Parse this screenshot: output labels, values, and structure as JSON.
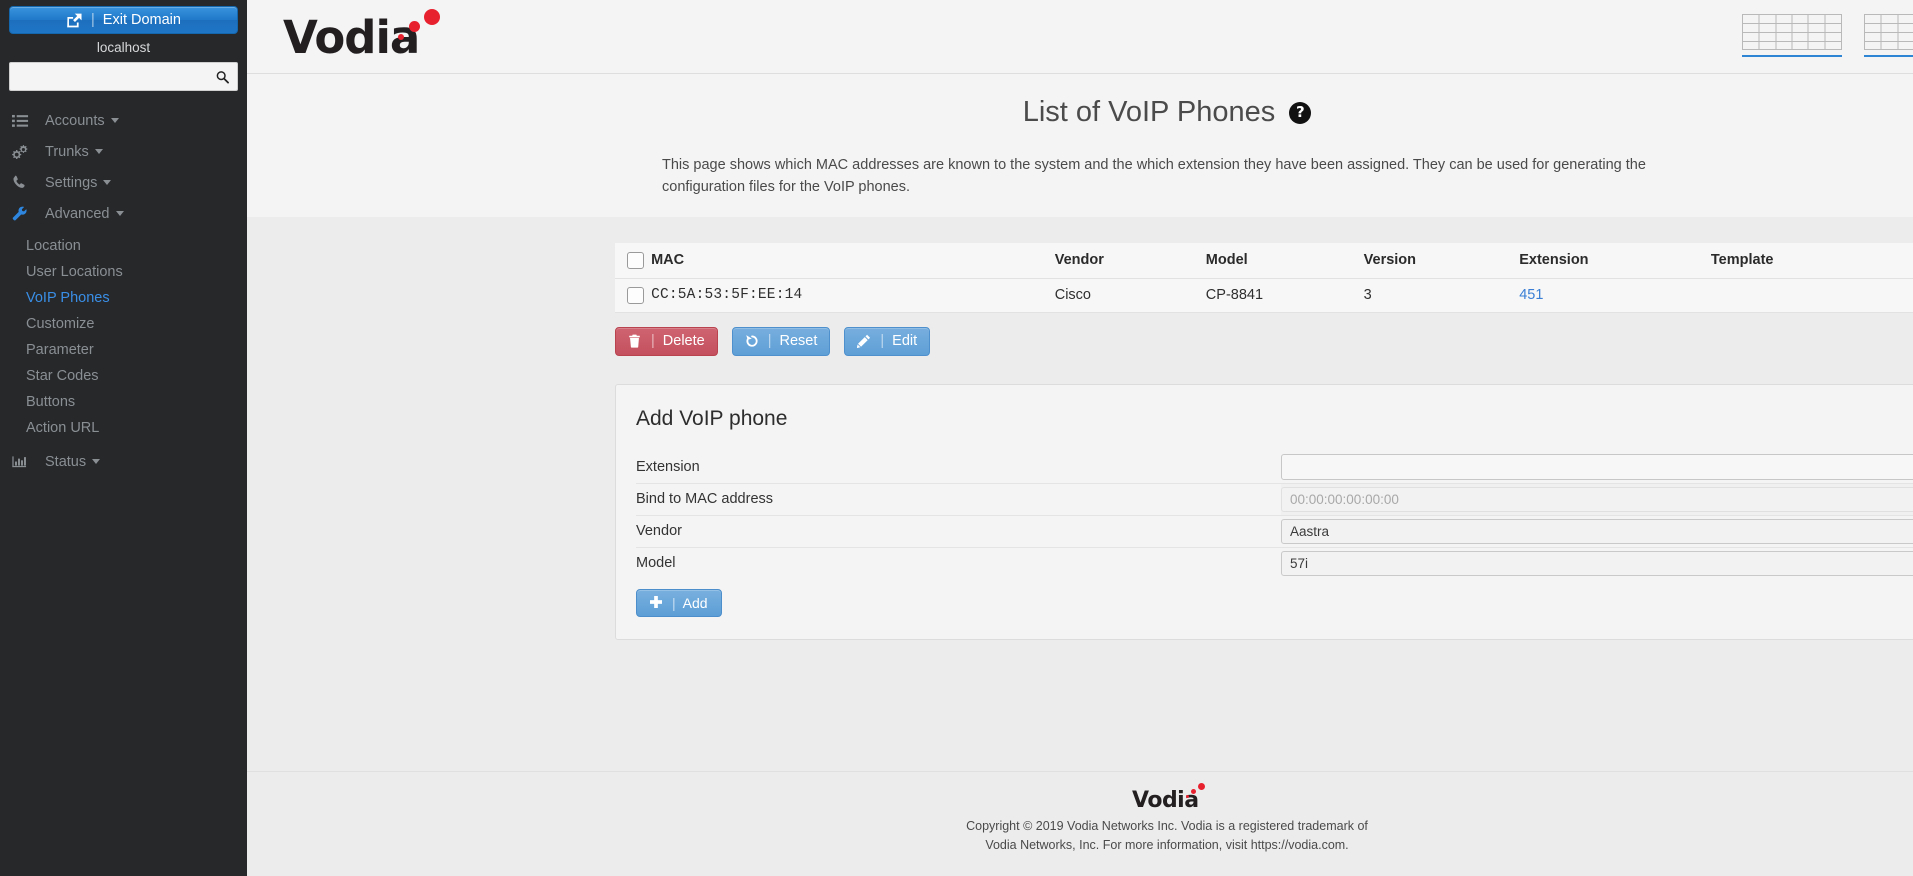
{
  "sidebar": {
    "exit_domain_label": "Exit Domain",
    "exit_domain_icon": "external-link-icon",
    "host": "localhost",
    "search_placeholder": "",
    "search_value": "",
    "search_icon": "search-icon",
    "nav": [
      {
        "label": "Accounts",
        "icon": "list-icon",
        "caret": true
      },
      {
        "label": "Trunks",
        "icon": "gears-icon",
        "caret": true
      },
      {
        "label": "Settings",
        "icon": "phone-icon",
        "caret": true
      },
      {
        "label": "Advanced",
        "icon": "wrench-icon",
        "caret": true,
        "active": true
      }
    ],
    "sub_items": [
      {
        "label": "Location",
        "selected": false
      },
      {
        "label": "User Locations",
        "selected": false
      },
      {
        "label": "VoIP Phones",
        "selected": true
      },
      {
        "label": "Customize",
        "selected": false
      },
      {
        "label": "Parameter",
        "selected": false
      },
      {
        "label": "Star Codes",
        "selected": false
      },
      {
        "label": "Buttons",
        "selected": false
      },
      {
        "label": "Action URL",
        "selected": false
      }
    ],
    "nav_bottom": [
      {
        "label": "Status",
        "icon": "bar-chart-icon",
        "caret": true
      }
    ]
  },
  "header": {
    "logo_text": "Vodia",
    "icons": [
      {
        "name": "grid-table-icon-1"
      },
      {
        "name": "grid-table-icon-2"
      },
      {
        "name": "logout-icon"
      }
    ]
  },
  "page": {
    "title": "List of VoIP Phones",
    "help_icon": "help-circle-icon",
    "help_glyph": "?",
    "description": "This page shows which MAC addresses are known to the system and the which extension they have been assigned. They can be used for generating the configuration files for the VoIP phones."
  },
  "table": {
    "columns": [
      "MAC",
      "Vendor",
      "Model",
      "Version",
      "Extension",
      "Template"
    ],
    "rows": [
      {
        "mac": "CC:5A:53:5F:EE:14",
        "vendor": "Cisco",
        "model": "CP-8841",
        "version": "3",
        "extension": "451",
        "template": ""
      }
    ]
  },
  "actions": {
    "delete_label": "Delete",
    "reset_label": "Reset",
    "edit_label": "Edit",
    "separator": "|",
    "delete_icon": "trash-icon",
    "reset_icon": "undo-icon",
    "edit_icon": "pencil-icon"
  },
  "form": {
    "title": "Add VoIP phone",
    "extension_label": "Extension",
    "extension_value": "",
    "extension_placeholder": "",
    "extension_add_icon": "plus-icon",
    "mac_label": "Bind to MAC address",
    "mac_value": "",
    "mac_placeholder": "00:00:00:00:00:00",
    "vendor_label": "Vendor",
    "vendor_value": "Aastra",
    "model_label": "Model",
    "model_value": "57i",
    "add_label": "Add",
    "add_icon": "plus-icon",
    "separator": "|"
  },
  "footer": {
    "logo_text": "Vodia",
    "copyright_line1": "Copyright © 2019 Vodia Networks Inc. Vodia is a registered trademark of",
    "copyright_line2": "Vodia Networks, Inc. For more information, visit https://vodia.com."
  },
  "colors": {
    "accent_blue": "#2d80c8",
    "link_blue": "#3a7fd5",
    "danger_red": "#c4505e",
    "logo_red": "#e8212f",
    "sidebar_bg": "#26282a"
  }
}
